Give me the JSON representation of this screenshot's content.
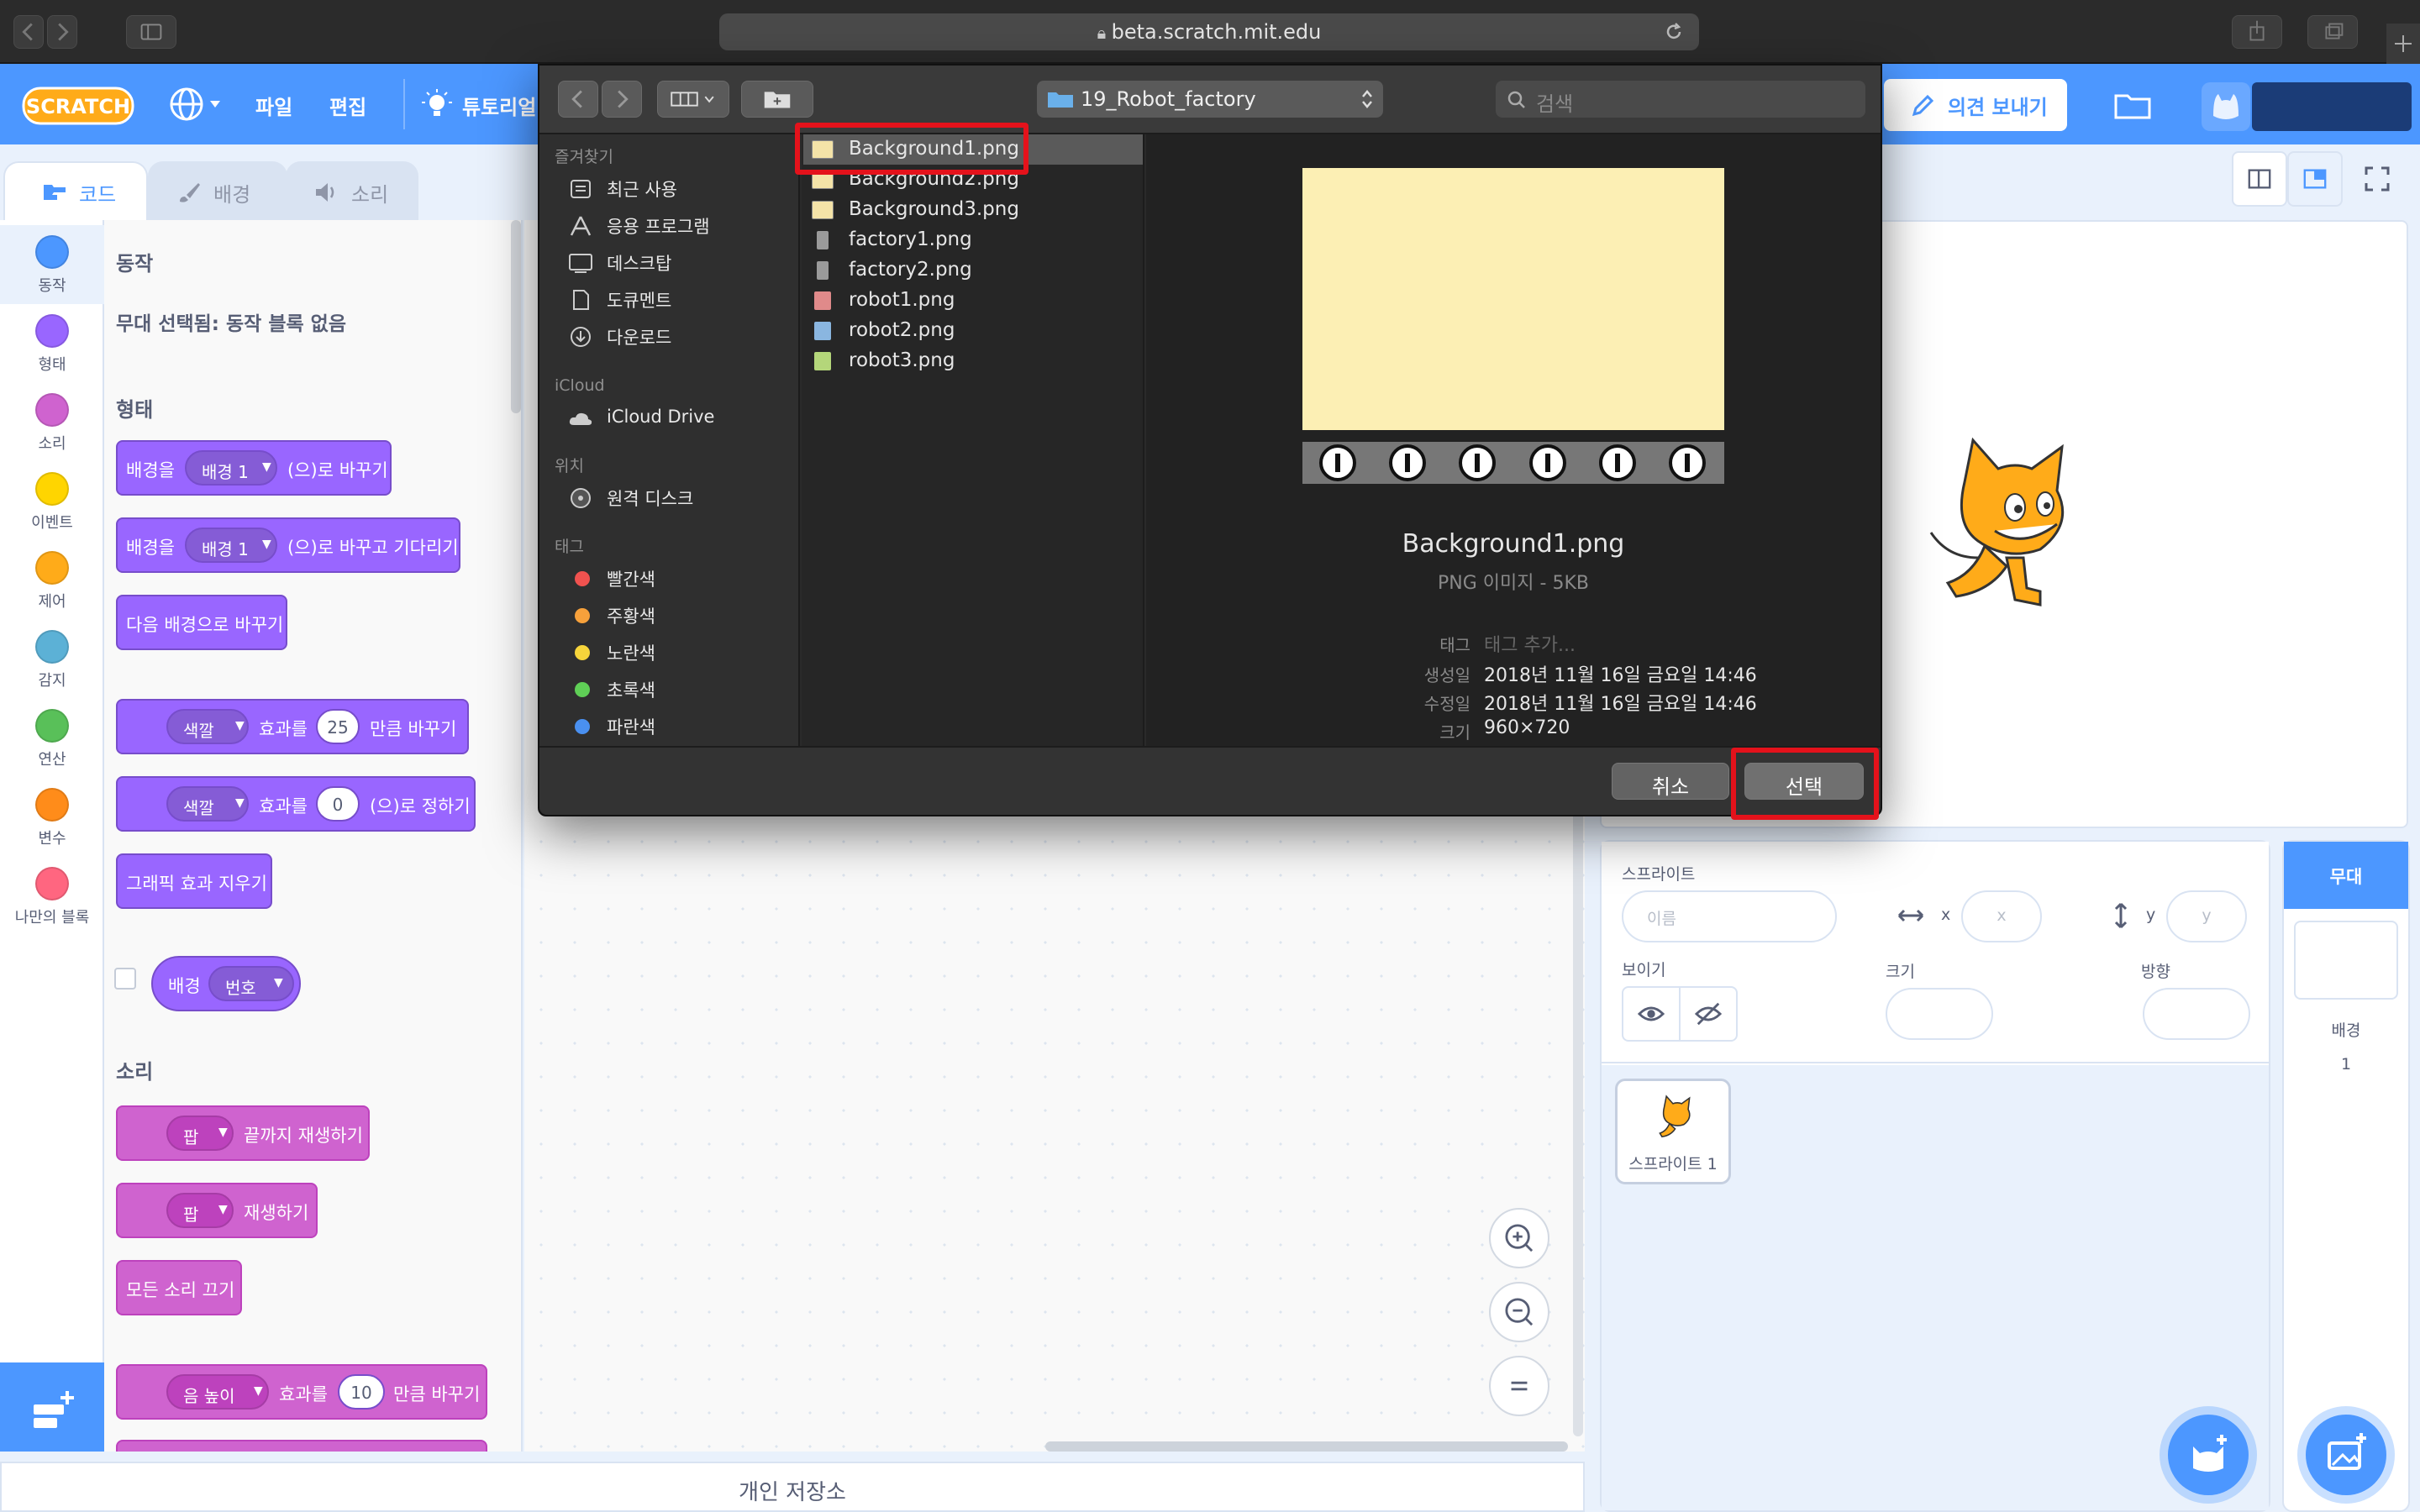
{
  "browser": {
    "url": "beta.scratch.mit.edu"
  },
  "menubar": {
    "items": [
      "파일",
      "편집"
    ],
    "tutorials": "튜토리얼",
    "feedback": "의견 보내기"
  },
  "tabs": {
    "code": "코드",
    "backdrop": "배경",
    "sound": "소리"
  },
  "categories": [
    {
      "label": "동작",
      "color": "#4c97ff"
    },
    {
      "label": "형태",
      "color": "#9966ff"
    },
    {
      "label": "소리",
      "color": "#cf63cf"
    },
    {
      "label": "이벤트",
      "color": "#ffd500"
    },
    {
      "label": "제어",
      "color": "#ffab19"
    },
    {
      "label": "감지",
      "color": "#5cb1d6"
    },
    {
      "label": "연산",
      "color": "#59c059"
    },
    {
      "label": "변수",
      "color": "#ff8c1a"
    },
    {
      "label": "나만의 블록",
      "color": "#ff6680"
    }
  ],
  "palette": {
    "motion_header": "동작",
    "motion_note": "무대 선택됨: 동작 블록 없음",
    "looks_header": "형태",
    "sound_header": "소리",
    "b1": {
      "pre": "배경을",
      "drop": "배경 1",
      "post": "(으)로 바꾸기"
    },
    "b2": {
      "pre": "배경을",
      "drop": "배경 1",
      "post": "(으)로 바꾸고 기다리기"
    },
    "b3": "다음 배경으로 바꾸기",
    "b4": {
      "drop": "색깔",
      "mid": "효과를",
      "num": "25",
      "post": "만큼 바꾸기"
    },
    "b5": {
      "drop": "색깔",
      "mid": "효과를",
      "num": "0",
      "post": "(으)로 정하기"
    },
    "b6": "그래픽 효과 지우기",
    "b7": {
      "pre": "배경",
      "drop": "번호"
    },
    "s1": {
      "drop": "팝",
      "post": "끝까지 재생하기"
    },
    "s2": {
      "drop": "팝",
      "post": "재생하기"
    },
    "s3": "모든 소리 끄기",
    "s4": {
      "drop": "음 높이",
      "mid": "효과를",
      "num": "10",
      "post": "만큼 바꾸기"
    }
  },
  "backpack": "개인 저장소",
  "sprite_info": {
    "sprite_label": "스프라이트",
    "name_placeholder": "이름",
    "x_label": "x",
    "x_placeholder": "x",
    "y_label": "y",
    "y_placeholder": "y",
    "show_label": "보이기",
    "size_label": "크기",
    "direction_label": "방향"
  },
  "sprite_tile": "스프라이트 1",
  "stage_panel": {
    "title": "무대",
    "backdrop_label": "배경",
    "backdrop_count": "1"
  },
  "dialog": {
    "folder": "19_Robot_factory",
    "search_placeholder": "검색",
    "favorites_header": "즐겨찾기",
    "favorites": [
      "최근 사용",
      "응용 프로그램",
      "데스크탑",
      "도큐멘트",
      "다운로드"
    ],
    "icloud_header": "iCloud",
    "icloud_drive": "iCloud Drive",
    "locations_header": "위치",
    "remote_disc": "원격 디스크",
    "tags_header": "태그",
    "tags": [
      {
        "label": "빨간색",
        "color": "#f0524f"
      },
      {
        "label": "주황색",
        "color": "#f7a13b"
      },
      {
        "label": "노란색",
        "color": "#f7d53b"
      },
      {
        "label": "초록색",
        "color": "#5fcf56"
      },
      {
        "label": "파란색",
        "color": "#4a90f0"
      }
    ],
    "files": [
      {
        "name": "Background1.png",
        "icon": "#f4e3a8"
      },
      {
        "name": "Background2.png",
        "icon": "#f4e3a8"
      },
      {
        "name": "Background3.png",
        "icon": "#f4e3a8"
      },
      {
        "name": "factory1.png",
        "icon": "#9a9a9a"
      },
      {
        "name": "factory2.png",
        "icon": "#9a9a9a"
      },
      {
        "name": "robot1.png",
        "icon": "#e08a8a"
      },
      {
        "name": "robot2.png",
        "icon": "#8ab6e0"
      },
      {
        "name": "robot3.png",
        "icon": "#b4d67a"
      }
    ],
    "preview": {
      "name": "Background1.png",
      "kind": "PNG 이미지 - 5KB",
      "tag_label": "태그",
      "tag_placeholder": "태그 추가...",
      "created_label": "생성일",
      "created": "2018년 11월 16일 금요일 14:46",
      "modified_label": "수정일",
      "modified": "2018년 11월 16일 금요일 14:46",
      "size_label": "크기",
      "size": "960×720"
    },
    "cancel": "취소",
    "choose": "선택"
  },
  "colors": {
    "scratch_blue": "#4c97ff",
    "looks": "#9966ff",
    "sound": "#cf63cf",
    "highlight": "#e4121b"
  }
}
